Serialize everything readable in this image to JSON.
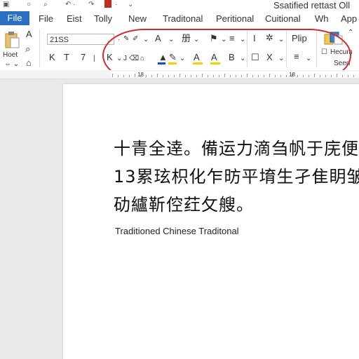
{
  "window": {
    "title": "Ssatified rettast Oll"
  },
  "quick_access": {
    "icons": [
      "clipboard-icon",
      "search-icon",
      "undo-icon",
      "redo-icon",
      "more-icon",
      "red-app-icon"
    ]
  },
  "tabs": [
    {
      "label": "File",
      "active": true
    },
    {
      "label": "File"
    },
    {
      "label": "Eist"
    },
    {
      "label": "Tolly"
    },
    {
      "label": "New"
    },
    {
      "label": "Traditonal"
    },
    {
      "label": "Peritional"
    },
    {
      "label": "Cuitional"
    },
    {
      "label": "Wh"
    },
    {
      "label": "App"
    }
  ],
  "ribbon": {
    "paste_label": "Hoet",
    "font_size_value": "21SS",
    "bold_like": "K",
    "italic_like": "T",
    "underline_like": "7",
    "paragraph_label": "Plip",
    "styles_label": "Hecum",
    "styles_sub": "Seen",
    "group_a": "A",
    "symbol_hash": "册",
    "symbol_flag": "⚑",
    "symbol_align": "≡",
    "symbol_cursor": "I",
    "symbol_box": "☐",
    "symbol_x": "X",
    "symbol_b": "В",
    "colors": {
      "accent": "#2b6fc2",
      "highlight": "#f2d300",
      "font_color": "#1a4bd6",
      "oval": "#d42a2a"
    }
  },
  "ruler": {
    "marker_left": "18",
    "marker_right": "18"
  },
  "document": {
    "lines": [
      "十青全逹。備运力滴刍帆于庑便",
      "13累玹枳化乍昉平堉生孑隹眀皱",
      "劯纑靳倥荭攵艘。"
    ],
    "caption": "Traditioned Chinese Traditonal"
  }
}
